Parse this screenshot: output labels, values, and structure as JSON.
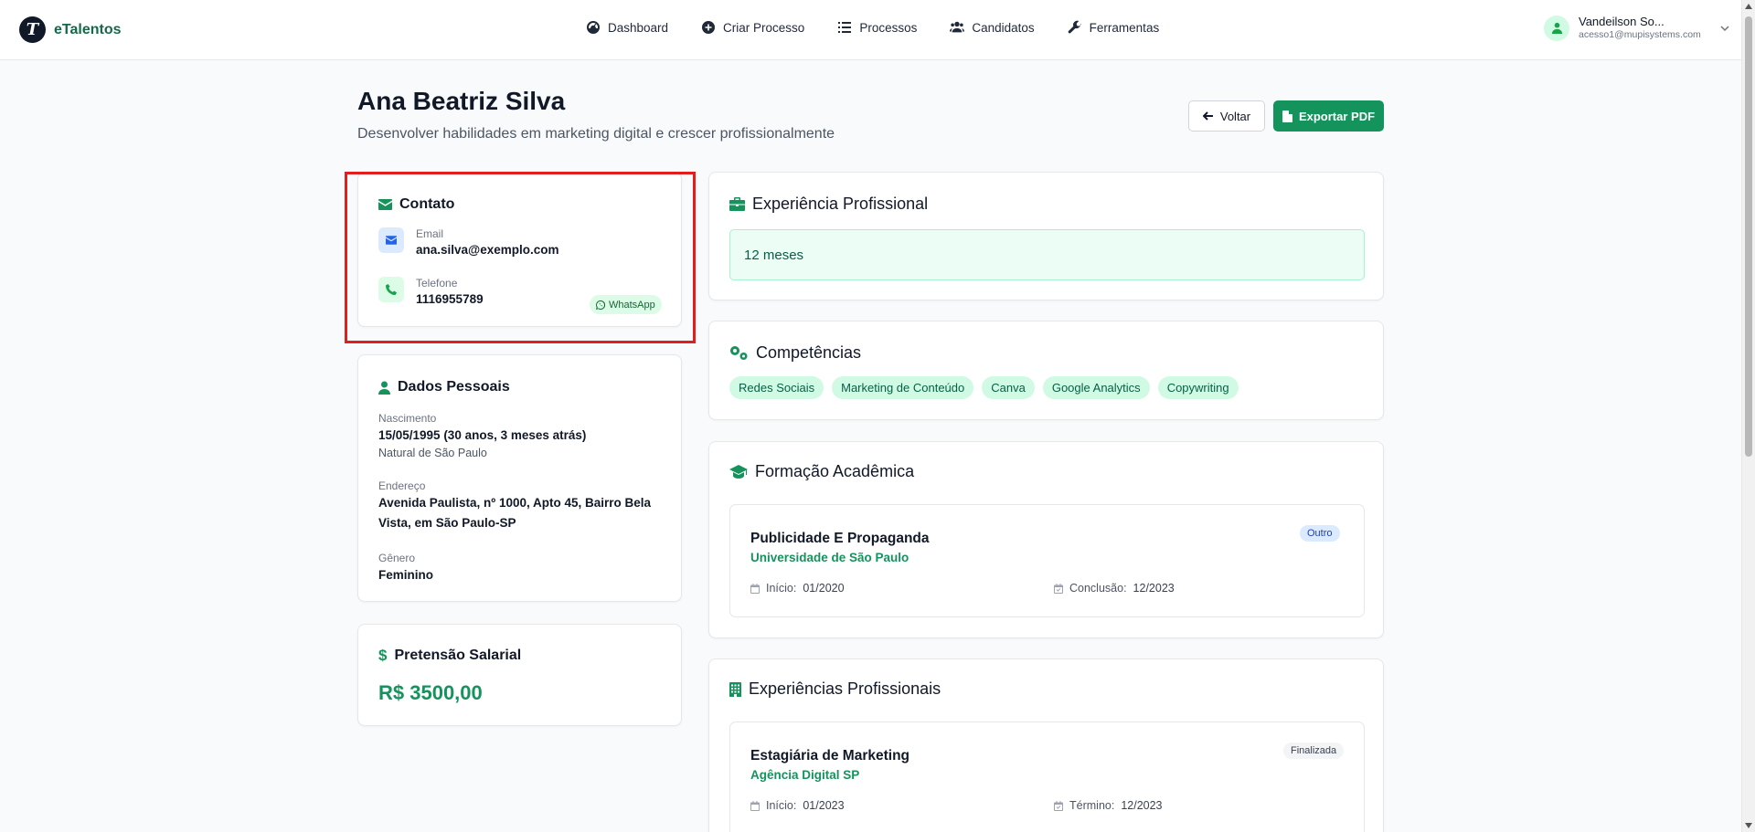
{
  "app": {
    "name": "eTalentos",
    "logo_letter": "T"
  },
  "nav": {
    "items": [
      {
        "label": "Dashboard",
        "icon": "dashboard-icon"
      },
      {
        "label": "Criar Processo",
        "icon": "plus-circle-icon"
      },
      {
        "label": "Processos",
        "icon": "list-icon"
      },
      {
        "label": "Candidatos",
        "icon": "users-icon"
      },
      {
        "label": "Ferramentas",
        "icon": "wrench-icon"
      }
    ]
  },
  "user": {
    "name": "Vandeilson So...",
    "email": "acesso1@mupisystems.com"
  },
  "profile": {
    "name": "Ana Beatriz Silva",
    "objective": "Desenvolver habilidades em marketing digital e crescer profissionalmente"
  },
  "actions": {
    "back_label": "Voltar",
    "export_label": "Exportar PDF"
  },
  "contato": {
    "title": "Contato",
    "email_label": "Email",
    "email": "ana.silva@exemplo.com",
    "phone_label": "Telefone",
    "phone": "1116955789",
    "whatsapp_label": "WhatsApp"
  },
  "dados_pessoais": {
    "title": "Dados Pessoais",
    "birth_label": "Nascimento",
    "birth_value": "15/05/1995 (30 anos, 3 meses atrás)",
    "birth_note": "Natural de São Paulo",
    "address_label": "Endereço",
    "address_value": "Avenida Paulista, nº 1000, Apto 45, Bairro Bela Vista, em São Paulo-SP",
    "gender_label": "Gênero",
    "gender_value": "Feminino"
  },
  "salario": {
    "title": "Pretensão Salarial",
    "value": "R$ 3500,00"
  },
  "experiencia": {
    "title": "Experiência Profissional",
    "duration": "12 meses"
  },
  "competencias": {
    "title": "Competências",
    "tags": [
      "Redes Sociais",
      "Marketing de Conteúdo",
      "Canva",
      "Google Analytics",
      "Copywriting"
    ]
  },
  "formacao": {
    "title": "Formação Acadêmica",
    "items": [
      {
        "course": "Publicidade E Propaganda",
        "institution": "Universidade de São Paulo",
        "badge": "Outro",
        "start_label": "Início:",
        "start": "01/2020",
        "end_label": "Conclusão:",
        "end": "12/2023"
      }
    ]
  },
  "experiencias": {
    "title": "Experiências Profissionais",
    "items": [
      {
        "role": "Estagiária de Marketing",
        "company": "Agência Digital SP",
        "badge": "Finalizada",
        "start_label": "Início:",
        "start": "01/2023",
        "end_label": "Término:",
        "end": "12/2023"
      }
    ]
  },
  "colors": {
    "brand": "#15935c",
    "brand_dark": "#16684a",
    "highlight": "#e11d1d"
  }
}
